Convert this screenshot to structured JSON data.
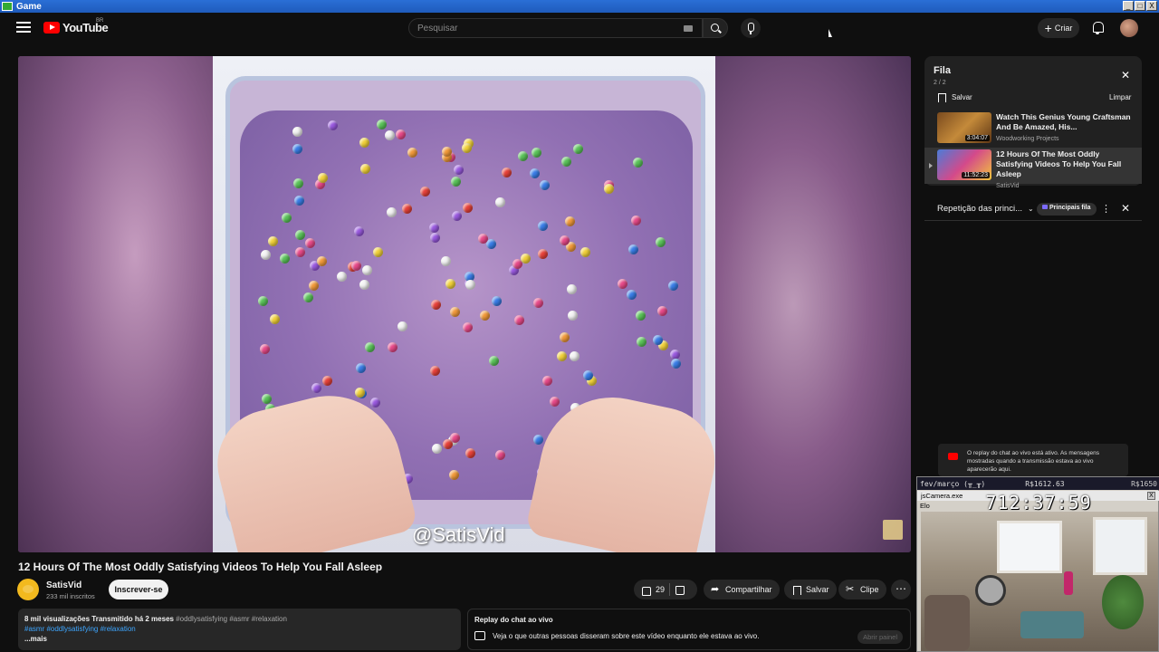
{
  "window": {
    "title": "Game",
    "buttons": [
      "_",
      "□",
      "X"
    ]
  },
  "header": {
    "brand": "YouTube",
    "region": "BR",
    "search_placeholder": "Pesquisar",
    "create_label": "Criar"
  },
  "video": {
    "overlay_text": "@SatisVid",
    "title": "12 Hours Of The Most Oddly Satisfying Videos To Help You Fall Asleep",
    "channel_name": "SatisVid",
    "channel_subs": "233 mil inscritos",
    "subscribe_label": "Inscrever-se",
    "likes": "29",
    "share_label": "Compartilhar",
    "save_label": "Salvar",
    "clip_label": "Clipe",
    "more_label": "⋯"
  },
  "description": {
    "stats": "8 mil visualizações  Transmitido há 2 meses",
    "tags_inline": "#oddlysatisfying #asmr #relaxation",
    "tags_line": "#asmr #oddlysatisfying #relaxation",
    "more": "...mais"
  },
  "chat_replay": {
    "title": "Replay do chat ao vivo",
    "body": "Veja o que outras pessoas disseram sobre este vídeo enquanto ele estava ao vivo.",
    "open_panel": "Abrir painel"
  },
  "queue": {
    "title": "Fila",
    "count": "2 / 2",
    "save_label": "Salvar",
    "clear_label": "Limpar",
    "items": [
      {
        "title": "Watch This Genius Young Craftsman And Be Amazed, His...",
        "channel": "Woodworking Projects",
        "duration": "3:04:07"
      },
      {
        "title": "12 Hours Of The Most Oddly Satisfying Videos To Help You Fall Asleep",
        "channel": "SatisVid",
        "duration": "11:52:23"
      }
    ]
  },
  "live_chat": {
    "mode_label": "Repetição das princi...",
    "badge_label": "Principais fila",
    "replay_note": "O replay do chat ao vivo está ativo. As mensagens mostradas quando a transmissão estava ao vivo aparecerão aqui."
  },
  "overlay": {
    "label": "fev/março (╥_╥)",
    "price1": "R$1612.63",
    "price2": "R$1650",
    "app_title": "jsCamera.exe",
    "menu": "Elo",
    "clock": "712:37:59",
    "close": "X"
  }
}
